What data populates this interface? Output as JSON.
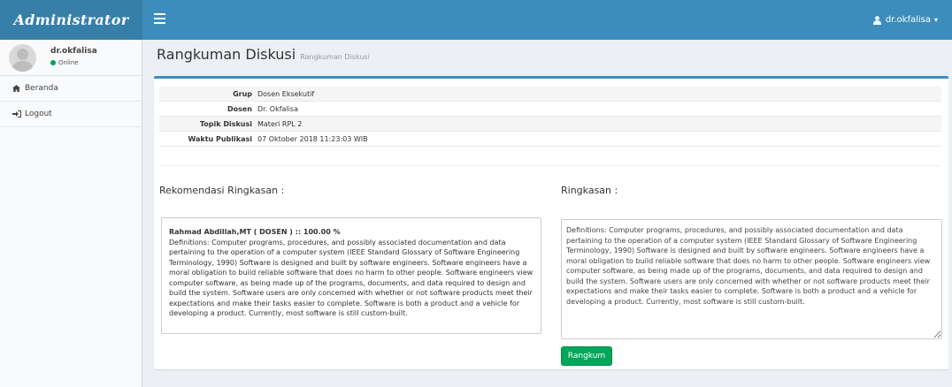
{
  "app": {
    "brand": "Administrator",
    "user_menu_label": "dr.okfalisa"
  },
  "sidebar": {
    "user_name": "dr.okfalisa",
    "status": "Online",
    "items": [
      {
        "label": "Beranda",
        "icon": "home-icon"
      },
      {
        "label": "Logout",
        "icon": "logout-icon"
      }
    ]
  },
  "header": {
    "title": "Rangkuman Diskusi",
    "subtitle": "Rangkuman Diskusi"
  },
  "info": [
    {
      "key": "Grup",
      "value": "Dosen Eksekutif"
    },
    {
      "key": "Dosen",
      "value": "Dr. Okfalisa"
    },
    {
      "key": "Topik Diskusi",
      "value": "Materi RPL 2"
    },
    {
      "key": "Waktu Publikasi",
      "value": "07 Oktober 2018 11:23:03 WIB"
    }
  ],
  "recommendation": {
    "heading": "Rekomendasi Ringkasan :",
    "author_score": "Rahmad Abdillah,MT ( DOSEN ) :: 100.00 %",
    "text": "Definitions: Computer programs, procedures, and possibly associated documentation and data pertaining to the operation of a computer system (IEEE Standard Glossary of Software Engineering Terminology, 1990) Software is designed and built by software engineers. Software engineers have a moral obligation to build reliable software that does no harm to other people. Software engineers view computer software, as being made up of the programs, documents, and data required to design and build the system. Software users are only concerned with whether or not software products meet their expectations and make their tasks easier to complete. Software is both a product and a vehicle for developing a product. Currently, most software is still custom-built."
  },
  "summary": {
    "heading": "Ringkasan :",
    "value": "Definitions: Computer programs, procedures, and possibly associated documentation and data pertaining to the operation of a computer system (IEEE Standard Glossary of Software Engineering Terminology, 1990) Software is designed and built by software engineers. Software engineers have a moral obligation to build reliable software that does no harm to other people. Software engineers view computer software, as being made up of the programs, documents, and data required to design and build the system. Software users are only concerned with whether or not software products meet their expectations and make their tasks easier to complete. Software is both a product and a vehicle for developing a product. Currently, most software is still custom-built.",
    "button_label": "Rangkum"
  },
  "colors": {
    "navbar": "#3c8dbc",
    "brand_bg": "#367fa9",
    "success": "#00a65a",
    "online": "#00a65a"
  }
}
